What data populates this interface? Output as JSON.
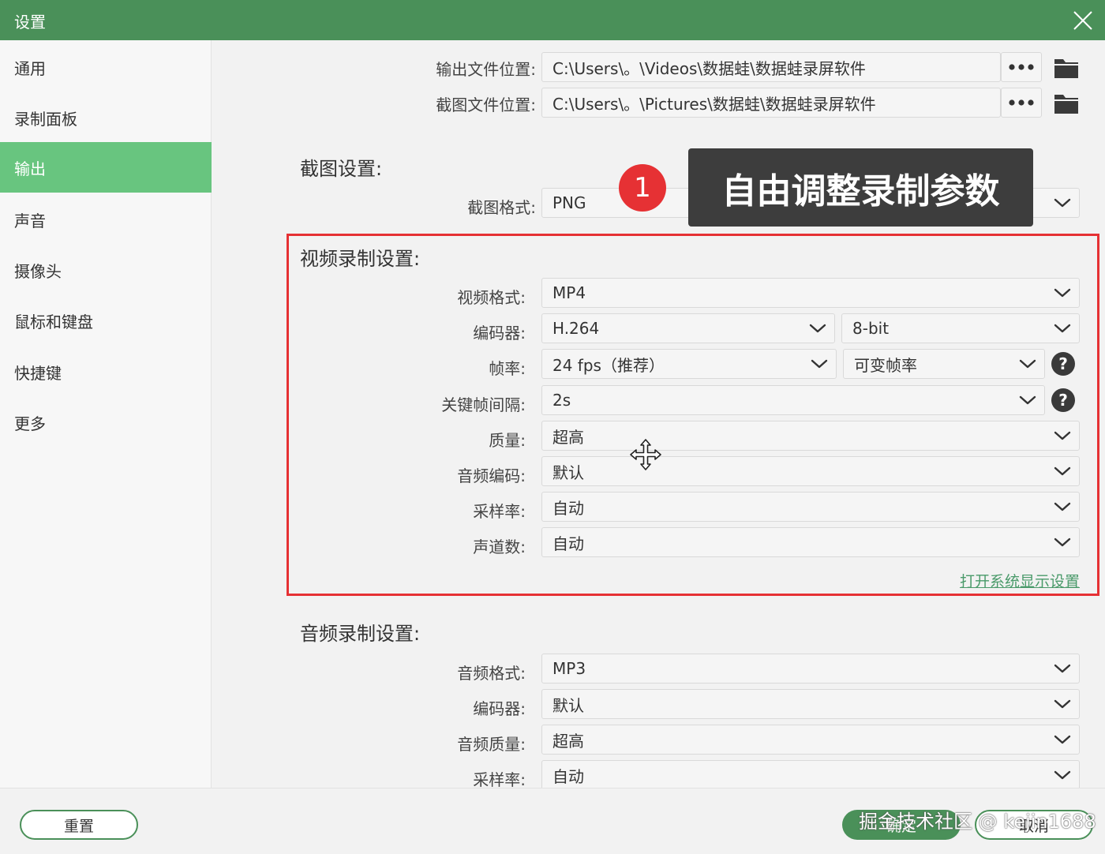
{
  "window": {
    "title": "设置"
  },
  "sidebar": {
    "items": [
      {
        "label": "通用"
      },
      {
        "label": "录制面板"
      },
      {
        "label": "输出",
        "active": true
      },
      {
        "label": "声音"
      },
      {
        "label": "摄像头"
      },
      {
        "label": "鼠标和键盘"
      },
      {
        "label": "快捷键"
      },
      {
        "label": "更多"
      }
    ]
  },
  "output": {
    "video_path_label": "输出文件位置:",
    "video_path": "C:\\Users\\。\\Videos\\数据蛙\\数据蛙录屏软件",
    "screenshot_path_label": "截图文件位置:",
    "screenshot_path": "C:\\Users\\。\\Pictures\\数据蛙\\数据蛙录屏软件"
  },
  "screenshot_settings": {
    "title": "截图设置:",
    "format_label": "截图格式:",
    "format": "PNG"
  },
  "annotation": {
    "badge": "1",
    "text": "自由调整录制参数"
  },
  "video_settings": {
    "title": "视频录制设置:",
    "format_label": "视频格式:",
    "format": "MP4",
    "encoder_label": "编码器:",
    "encoder": "H.264",
    "bit_depth": "8-bit",
    "framerate_label": "帧率:",
    "framerate": "24 fps（推荐）",
    "framerate_mode": "可变帧率",
    "keyframe_label": "关键帧间隔:",
    "keyframe": "2s",
    "quality_label": "质量:",
    "quality": "超高",
    "audio_codec_label": "音频编码:",
    "audio_codec": "默认",
    "sample_rate_label": "采样率:",
    "sample_rate": "自动",
    "channels_label": "声道数:",
    "channels": "自动",
    "display_settings_link": "打开系统显示设置"
  },
  "audio_settings": {
    "title": "音频录制设置:",
    "format_label": "音频格式:",
    "format": "MP3",
    "encoder_label": "编码器:",
    "encoder": "默认",
    "quality_label": "音频质量:",
    "quality": "超高",
    "sample_rate_label": "采样率:",
    "sample_rate": "自动"
  },
  "footer": {
    "reset_label": "重置",
    "ok_label": "确定",
    "cancel_label": "取消",
    "watermark": "掘金技术社区 @ kejin1688"
  },
  "colors": {
    "titlebar": "#4a9059",
    "active_nav": "#68c57f",
    "highlight_frame": "#e63134",
    "link": "#4a9a6a"
  }
}
